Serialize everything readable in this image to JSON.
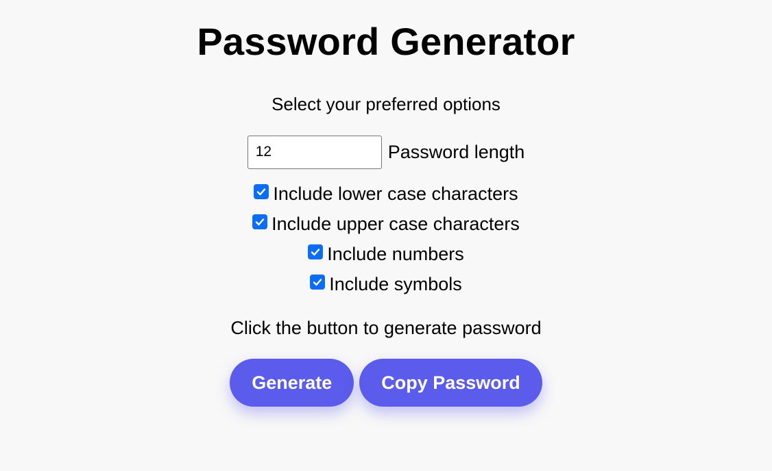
{
  "title": "Password Generator",
  "subtitle": "Select your preferred options",
  "length": {
    "value": "12",
    "label": "Password length"
  },
  "options": [
    {
      "label": "Include lower case characters",
      "checked": true
    },
    {
      "label": "Include upper case characters",
      "checked": true
    },
    {
      "label": "Include numbers",
      "checked": true
    },
    {
      "label": "Include symbols",
      "checked": true
    }
  ],
  "instruction": "Click the button to generate password",
  "buttons": {
    "generate": "Generate",
    "copy": "Copy Password"
  },
  "colors": {
    "accent": "#5b5bec",
    "checkbox": "#0b6df6",
    "background": "#f8f8f8"
  },
  "icons": {
    "checkbox": "checkmark-icon"
  }
}
